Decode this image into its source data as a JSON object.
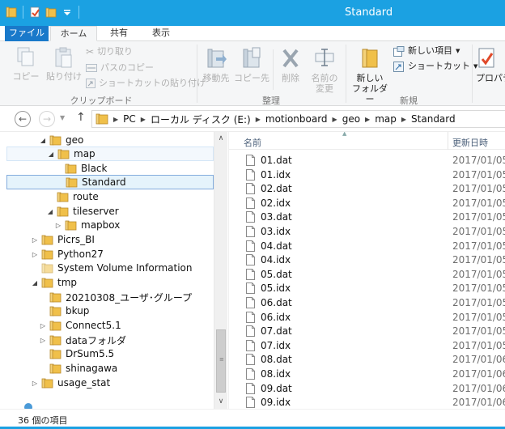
{
  "window": {
    "title": "Standard"
  },
  "ribbon": {
    "tabs": [
      "ファイル",
      "ホーム",
      "共有",
      "表示"
    ],
    "clipboard": {
      "copy": "コピー",
      "paste": "貼り付け",
      "cut": "切り取り",
      "copy_path": "パスのコピー",
      "paste_shortcut": "ショートカットの貼り付け",
      "group": "クリップボード"
    },
    "organize": {
      "move_to": "移動先",
      "copy_to": "コピー先",
      "delete": "削除",
      "rename_l1": "名前の",
      "rename_l2": "変更",
      "group": "整理"
    },
    "new": {
      "new_folder_l1": "新しい",
      "new_folder_l2": "フォルダー",
      "new_item": "新しい項目",
      "shortcut": "ショートカット",
      "group": "新規"
    },
    "open": {
      "properties": "プロパティ"
    }
  },
  "address": {
    "segments": [
      "PC",
      "ローカル ディスク (E:)",
      "motionboard",
      "geo",
      "map",
      "Standard"
    ]
  },
  "tree": {
    "items": [
      {
        "label": "geo",
        "arrow": "◢",
        "selected": false
      },
      {
        "label": "map",
        "arrow": "◢",
        "selected": false
      },
      {
        "label": "Black",
        "arrow": "",
        "selected": false
      },
      {
        "label": "Standard",
        "arrow": "",
        "selected": true
      },
      {
        "label": "route",
        "arrow": "",
        "selected": false
      },
      {
        "label": "tileserver",
        "arrow": "◢",
        "selected": false
      },
      {
        "label": "mapbox",
        "arrow": "▷",
        "selected": false
      },
      {
        "label": "Picrs_BI",
        "arrow": "▷",
        "selected": false
      },
      {
        "label": "Python27",
        "arrow": "▷",
        "selected": false
      },
      {
        "label": "System Volume Information",
        "arrow": "",
        "selected": false
      },
      {
        "label": "tmp",
        "arrow": "◢",
        "selected": false
      },
      {
        "label": "20210308_ユーザ･グループ",
        "arrow": "",
        "selected": false
      },
      {
        "label": "bkup",
        "arrow": "",
        "selected": false
      },
      {
        "label": "Connect5.1",
        "arrow": "▷",
        "selected": false
      },
      {
        "label": "dataフォルダ",
        "arrow": "▷",
        "selected": false
      },
      {
        "label": "DrSum5.5",
        "arrow": "",
        "selected": false
      },
      {
        "label": "shinagawa",
        "arrow": "",
        "selected": false
      },
      {
        "label": "usage_stat",
        "arrow": "▷",
        "selected": false
      }
    ]
  },
  "files": {
    "col_name": "名前",
    "col_date": "更新日時",
    "rows": [
      {
        "name": "01.dat",
        "date": "2017/01/05"
      },
      {
        "name": "01.idx",
        "date": "2017/01/05"
      },
      {
        "name": "02.dat",
        "date": "2017/01/05"
      },
      {
        "name": "02.idx",
        "date": "2017/01/05"
      },
      {
        "name": "03.dat",
        "date": "2017/01/05"
      },
      {
        "name": "03.idx",
        "date": "2017/01/05"
      },
      {
        "name": "04.dat",
        "date": "2017/01/05"
      },
      {
        "name": "04.idx",
        "date": "2017/01/05"
      },
      {
        "name": "05.dat",
        "date": "2017/01/05"
      },
      {
        "name": "05.idx",
        "date": "2017/01/05"
      },
      {
        "name": "06.dat",
        "date": "2017/01/05"
      },
      {
        "name": "06.idx",
        "date": "2017/01/05"
      },
      {
        "name": "07.dat",
        "date": "2017/01/05"
      },
      {
        "name": "07.idx",
        "date": "2017/01/05"
      },
      {
        "name": "08.dat",
        "date": "2017/01/06"
      },
      {
        "name": "08.idx",
        "date": "2017/01/06"
      },
      {
        "name": "09.dat",
        "date": "2017/01/06"
      },
      {
        "name": "09.idx",
        "date": "2017/01/06"
      }
    ]
  },
  "status": {
    "item_count": "36 個の項目"
  },
  "colors": {
    "accent": "#1ba1e2",
    "file_tab": "#1979ca",
    "folder": "#e8b84a",
    "selection": "#e5f3fb"
  }
}
